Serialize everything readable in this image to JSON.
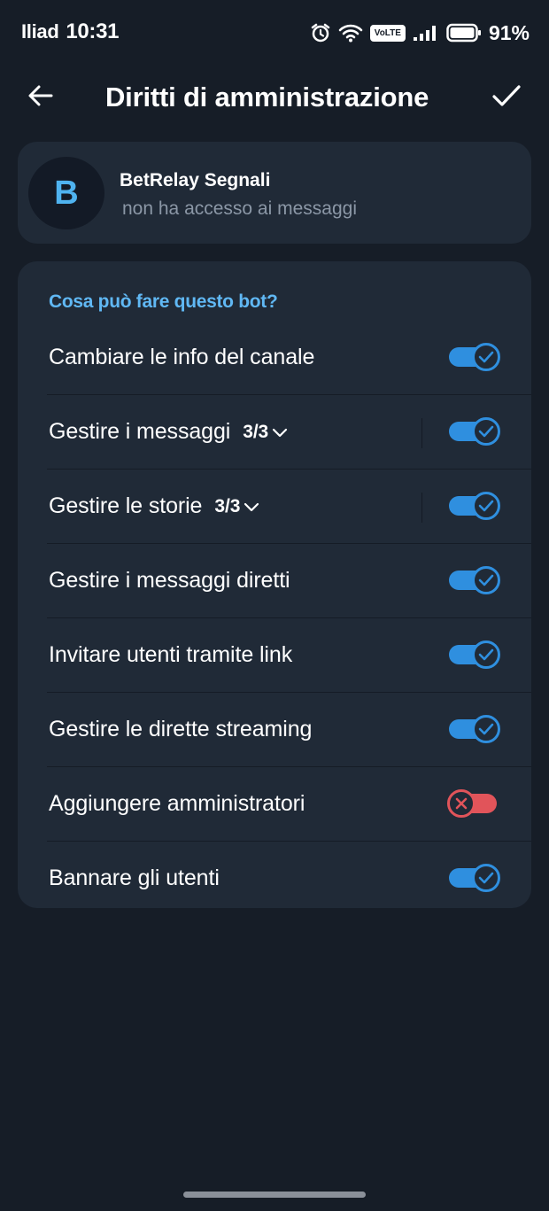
{
  "status_bar": {
    "carrier": "Iliad",
    "time": "10:31",
    "volte": "VoLTE",
    "battery": "91%"
  },
  "header": {
    "title": "Diritti di amministrazione",
    "back_icon": "arrow-left-icon",
    "done_icon": "check-icon"
  },
  "bot": {
    "avatar_letter": "B",
    "name": "BetRelay Segnali",
    "status": "non ha accesso ai messaggi"
  },
  "permissions": {
    "title": "Cosa può fare questo bot?",
    "items": [
      {
        "label": "Cambiare le info del canale",
        "enabled": true
      },
      {
        "label": "Gestire i messaggi",
        "count": "3/3",
        "enabled": true
      },
      {
        "label": "Gestire le storie",
        "count": "3/3",
        "enabled": true
      },
      {
        "label": "Gestire i messaggi diretti",
        "enabled": true
      },
      {
        "label": "Invitare utenti tramite link",
        "enabled": true
      },
      {
        "label": "Gestire le dirette streaming",
        "enabled": true
      },
      {
        "label": "Aggiungere amministratori",
        "enabled": false
      },
      {
        "label": "Bannare gli utenti",
        "enabled": true
      }
    ]
  },
  "colors": {
    "background": "#161d27",
    "card": "#202a37",
    "accent": "#2f8fdf",
    "accent_text": "#60b8f4",
    "danger": "#e1545a"
  }
}
